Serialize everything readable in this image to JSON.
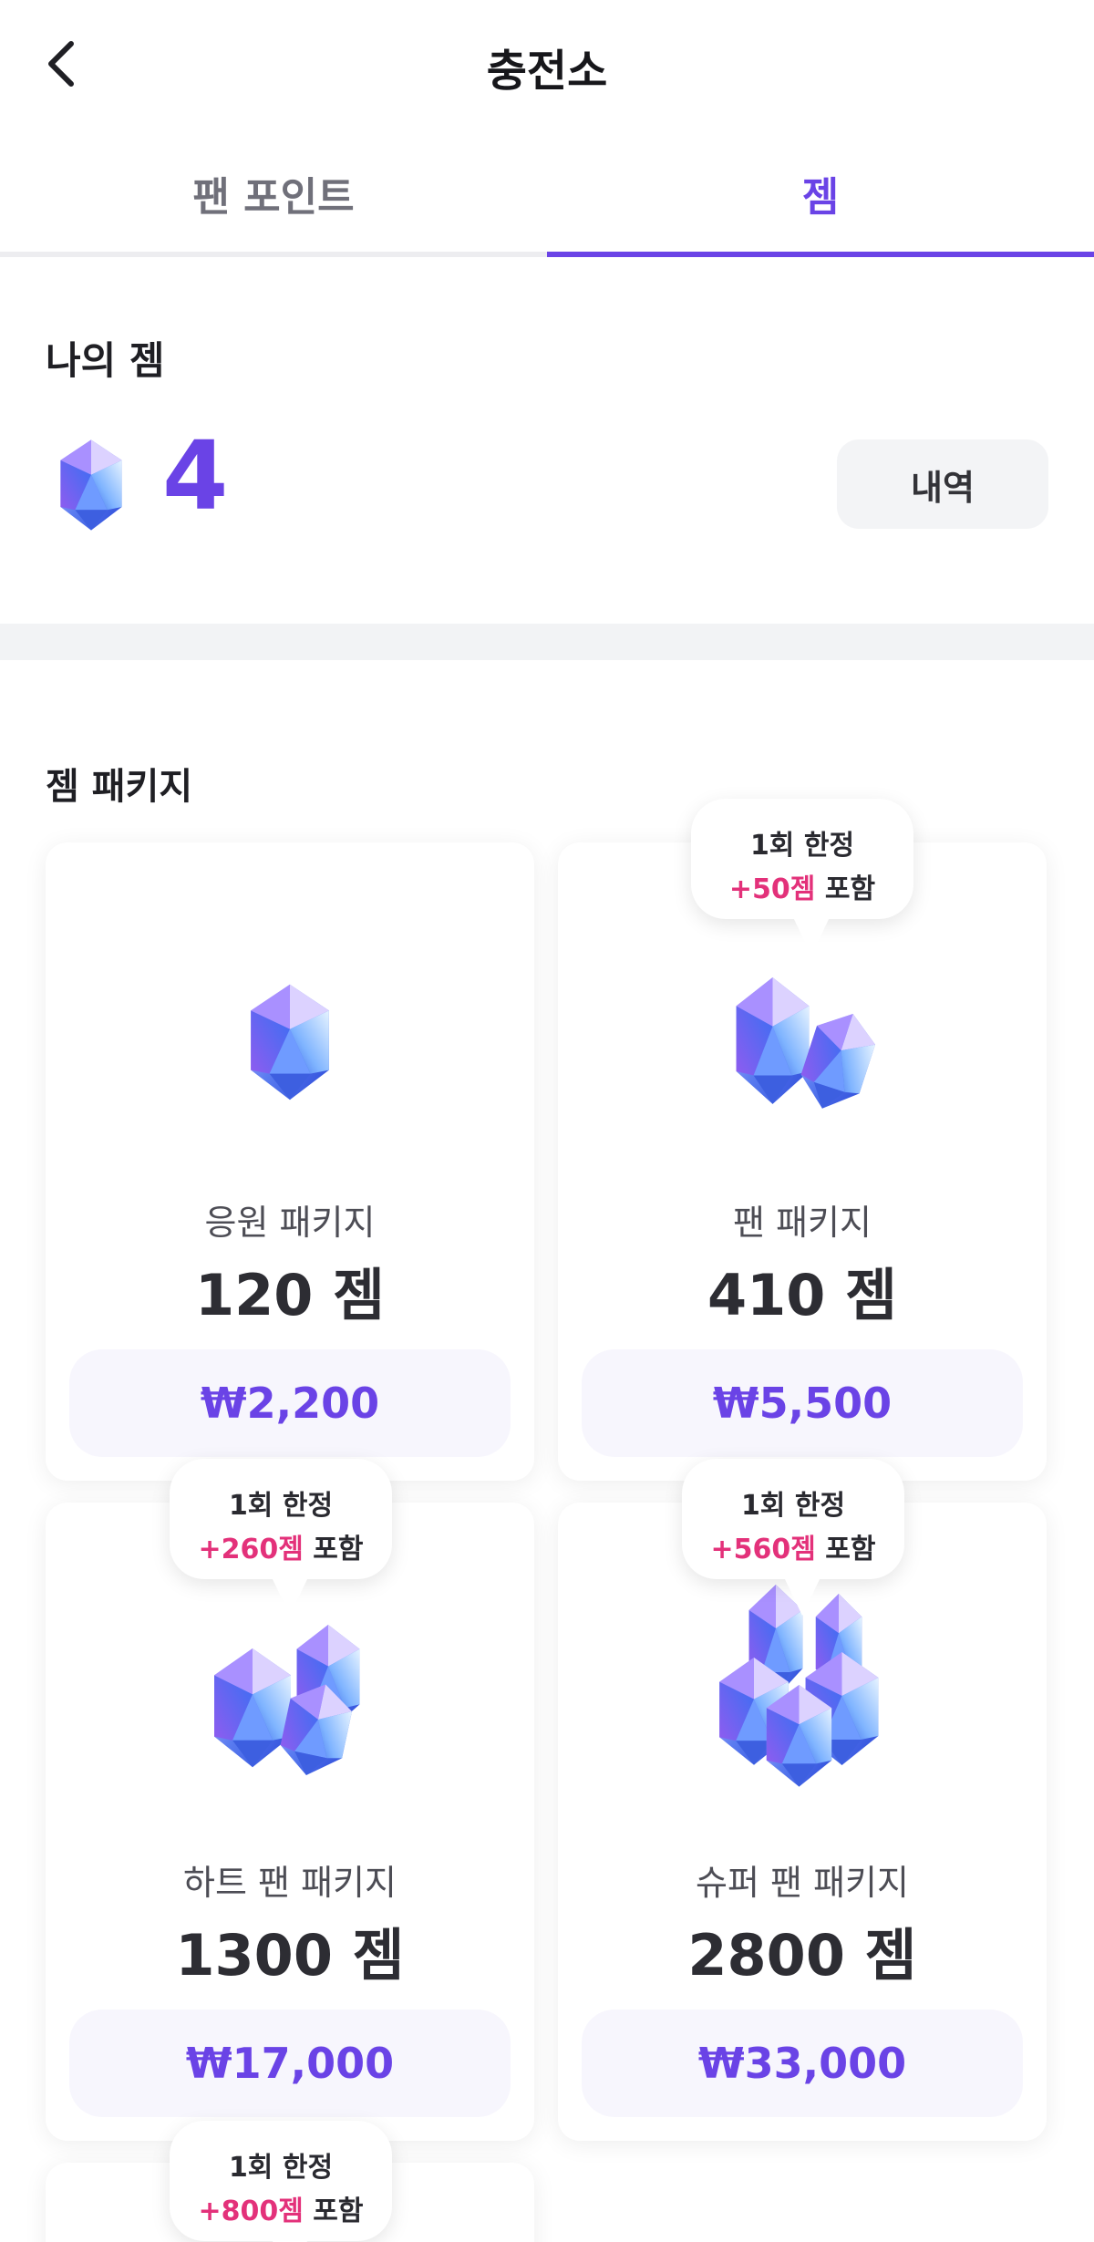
{
  "header": {
    "title": "충전소"
  },
  "tabs": [
    {
      "label": "팬 포인트",
      "active": false
    },
    {
      "label": "젬",
      "active": true
    }
  ],
  "my_gem": {
    "label": "나의 젬",
    "count": "4",
    "history_label": "내역"
  },
  "section": {
    "title": "젬 패키지"
  },
  "packages": [
    {
      "name": "응원 패키지",
      "amount": "120 젬",
      "price": "₩2,200",
      "badge": null
    },
    {
      "name": "팬 패키지",
      "amount": "410 젬",
      "price": "₩5,500",
      "badge": {
        "line1": "1회 한정",
        "bonus": "+50젬",
        "suffix": " 포함"
      }
    },
    {
      "name": "하트 팬 패키지",
      "amount": "1300 젬",
      "price": "₩17,000",
      "badge": {
        "line1": "1회 한정",
        "bonus": "+260젬",
        "suffix": " 포함"
      }
    },
    {
      "name": "슈퍼 팬 패키지",
      "amount": "2800 젬",
      "price": "₩33,000",
      "badge": {
        "line1": "1회 한정",
        "bonus": "+560젬",
        "suffix": " 포함"
      }
    },
    {
      "badge": {
        "line1": "1회 한정",
        "bonus": "+800젬",
        "suffix": " 포함"
      }
    }
  ],
  "colors": {
    "accent": "#6a43e6",
    "bonus": "#e3317a",
    "band": "#f2f3f5",
    "price_bg": "#f7f6fd"
  },
  "icons": {
    "back": "chevron-left-icon",
    "gem": "gem-icon"
  }
}
